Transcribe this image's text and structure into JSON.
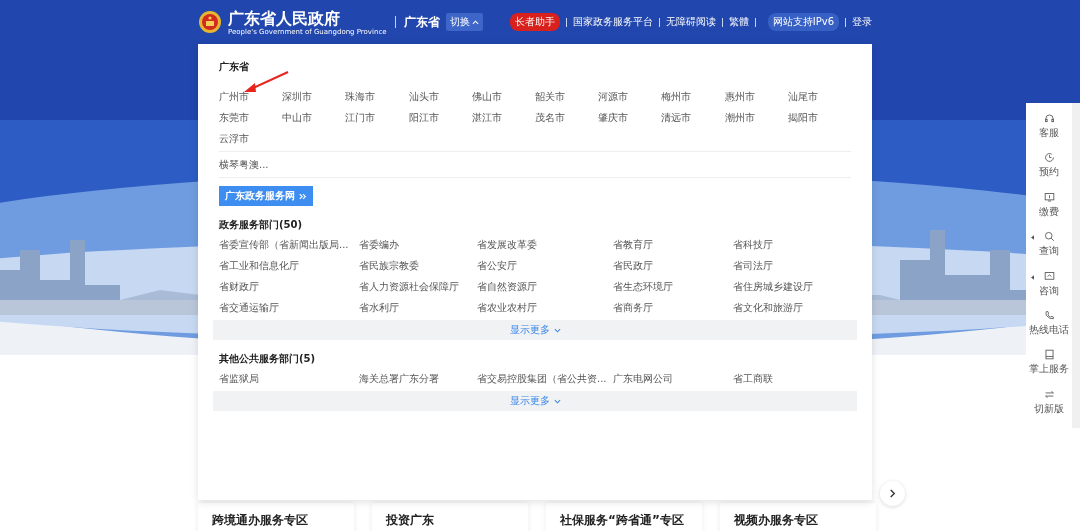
{
  "header": {
    "title": "广东省人民政府",
    "subtitle": "People's Government of Guangdong Province",
    "region": "广东省",
    "switch": "切换",
    "links": [
      {
        "label": "长者助手",
        "kind": "pill-red"
      },
      {
        "label": "国家政务服务平台",
        "kind": "link"
      },
      {
        "label": "无障碍阅读",
        "kind": "link"
      },
      {
        "label": "繁體",
        "kind": "link"
      },
      {
        "label": "网站支持IPv6",
        "kind": "pill"
      },
      {
        "label": "登录",
        "kind": "link"
      }
    ]
  },
  "dropdown": {
    "province": {
      "title": "广东省",
      "cities": [
        "广州市",
        "深圳市",
        "珠海市",
        "汕头市",
        "佛山市",
        "韶关市",
        "河源市",
        "梅州市",
        "惠州市",
        "汕尾市",
        "东莞市",
        "中山市",
        "江门市",
        "阳江市",
        "湛江市",
        "茂名市",
        "肇庆市",
        "清远市",
        "潮州市",
        "揭阳市",
        "云浮市"
      ],
      "extra": "横琴粤澳...",
      "button": "广东政务服务网"
    },
    "sections": [
      {
        "title": "政务服务部门(50)",
        "items": [
          "省委宣传部（省新闻出版局...",
          "省委编办",
          "省发展改革委",
          "省教育厅",
          "省科技厅",
          "省工业和信息化厅",
          "省民族宗教委",
          "省公安厅",
          "省民政厅",
          "省司法厅",
          "省财政厅",
          "省人力资源社会保障厅",
          "省自然资源厅",
          "省生态环境厅",
          "省住房城乡建设厅",
          "省交通运输厅",
          "省水利厅",
          "省农业农村厅",
          "省商务厅",
          "省文化和旅游厅"
        ],
        "more": "显示更多"
      },
      {
        "title": "其他公共服务部门(5)",
        "items": [
          "省监狱局",
          "海关总署广东分署",
          "省交易控股集团（省公共资...",
          "广东电网公司",
          "省工商联"
        ],
        "more": "显示更多"
      }
    ]
  },
  "cards": [
    "跨境通办服务专区",
    "投资广东",
    "社保服务“跨省通”专区",
    "视频办服务专区"
  ],
  "sidebar": [
    {
      "label": "客服",
      "kind": "headset",
      "submenu": false
    },
    {
      "label": "预约",
      "kind": "clock",
      "submenu": false
    },
    {
      "label": "缴费",
      "kind": "monitor",
      "submenu": false
    },
    {
      "label": "查询",
      "kind": "search",
      "submenu": true
    },
    {
      "label": "咨询",
      "kind": "chat",
      "submenu": true
    },
    {
      "label": "热线电话",
      "kind": "phone",
      "submenu": false
    },
    {
      "label": "掌上服务",
      "kind": "tablet",
      "submenu": false
    },
    {
      "label": "切新版",
      "kind": "swap",
      "submenu": false
    }
  ]
}
